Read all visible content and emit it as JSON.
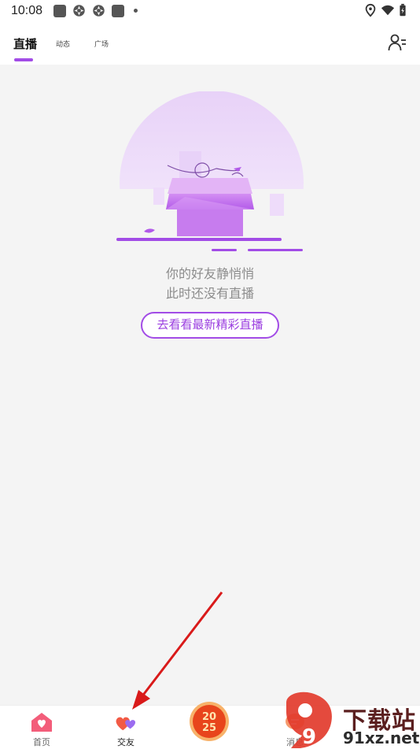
{
  "status_bar": {
    "time": "10:08",
    "left_icons": [
      "app-square-icon",
      "aperture-icon",
      "aperture-icon",
      "app-square-icon",
      "dot-icon"
    ],
    "right_icons": [
      "location-icon",
      "wifi-icon",
      "battery-icon"
    ]
  },
  "header": {
    "tabs": [
      {
        "label": "直播",
        "active": true
      },
      {
        "label": "动态",
        "active": false
      },
      {
        "label": "广场",
        "active": false
      }
    ],
    "accent": "#a24ce6",
    "right_icon": "user-menu-icon"
  },
  "empty_state": {
    "line1": "你的好友静悄悄",
    "line2": "此时还没有直播",
    "cta_label": "去看看最新精彩直播"
  },
  "bottom_nav": {
    "items": [
      {
        "label": "首页",
        "icon": "home-icon"
      },
      {
        "label": "交友",
        "icon": "hearts-icon"
      },
      {
        "label": "",
        "icon": "center-badge-icon"
      },
      {
        "label": "消息",
        "icon": "message-icon"
      }
    ]
  },
  "watermark": {
    "brand": "下载站",
    "url": "91xz.net",
    "number": "9"
  }
}
